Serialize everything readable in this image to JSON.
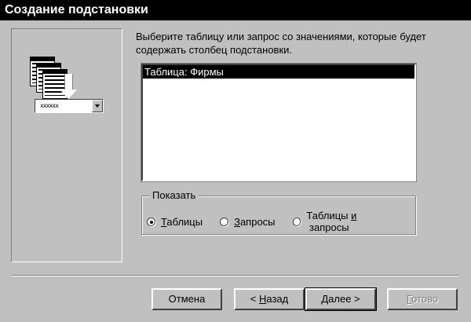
{
  "window": {
    "title": "Создание подстановки"
  },
  "instruction": "Выберите таблицу или запрос со значениями, которые будет содержать столбец подстановки.",
  "list": {
    "items": [
      {
        "label": "Таблица: Фирмы",
        "selected": true
      }
    ]
  },
  "show_group": {
    "legend": "Показать",
    "options": [
      {
        "prefix": "",
        "hotkey": "Т",
        "rest": "аблицы",
        "checked": true
      },
      {
        "prefix": "",
        "hotkey": "З",
        "rest": "апросы",
        "checked": false
      },
      {
        "prefix": "Таблицы ",
        "hotkey": "и",
        "rest": " запросы",
        "checked": false
      }
    ]
  },
  "illustration": {
    "combo_text": "xxxxxx",
    "icons": [
      "table-icon",
      "arrow-down-icon",
      "combo-box-icon"
    ]
  },
  "buttons": {
    "cancel": "Отмена",
    "back_prefix": "< ",
    "back_hotkey": "Н",
    "back_rest": "азад",
    "next_prefix": "",
    "next_hotkey": "Д",
    "next_rest": "алее >",
    "finish_hotkey": "Г",
    "finish_rest": "отово"
  }
}
